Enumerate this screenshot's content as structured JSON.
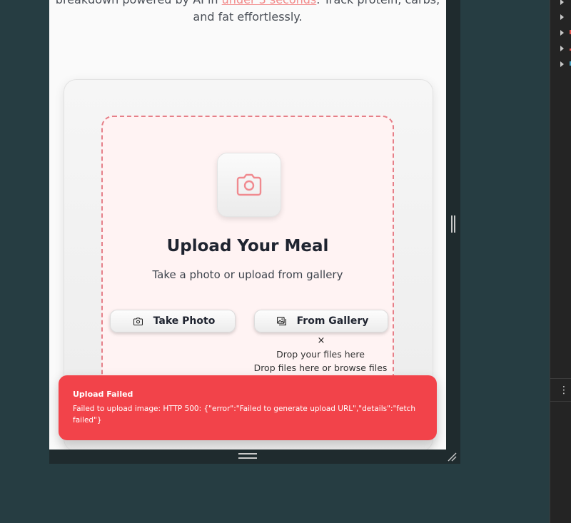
{
  "hero": {
    "line1_prefix": "breakdown powered by AI in ",
    "line1_highlight": "under 3 seconds",
    "line1_suffix": ". Track protein, carbs,",
    "line2": "and fat effortlessly."
  },
  "upload": {
    "title": "Upload Your Meal",
    "subtitle": "Take a photo or upload from gallery",
    "take_photo_label": "Take Photo",
    "from_gallery_label": "From Gallery",
    "close_glyph": "×",
    "drop_text": "Drop your files here",
    "drop_browse_text": "Drop files here or browse files"
  },
  "toast": {
    "title": "Upload Failed",
    "message": "Failed to upload image: HTTP 500: {\"error\":\"Failed to generate upload URL\",\"details\":\"fetch failed\"}"
  },
  "devtools": {
    "menu_glyph": "⋮"
  },
  "colors": {
    "accent": "#f28a8a",
    "dropzone_border": "#e67f88",
    "toast_bg": "#f2434a"
  },
  "icons": {
    "camera_tile": "camera-icon",
    "take_photo": "camera-icon",
    "from_gallery": "gallery-icon"
  }
}
